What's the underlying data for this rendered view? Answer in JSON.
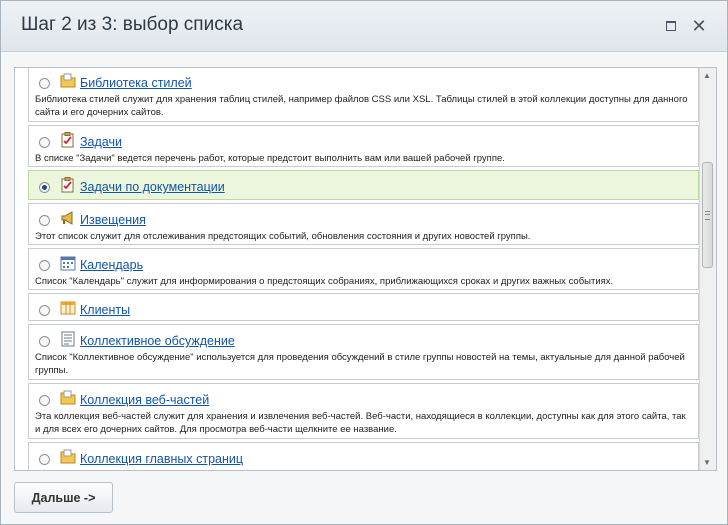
{
  "dialog": {
    "title": "Шаг 2 из 3: выбор списка",
    "maximize_icon": "maximize-icon",
    "close_icon": "close-icon",
    "close_glyph": "✕"
  },
  "items": [
    {
      "title": "Библиотека стилей",
      "icon": "folder-icon",
      "selected": false,
      "desc": "Библиотека стилей служит для хранения таблиц стилей, например файлов CSS или XSL. Таблицы стилей в этой коллекции доступны для данного сайта и его дочерних сайтов."
    },
    {
      "title": "Задачи",
      "icon": "tasks-icon",
      "selected": false,
      "desc": "В списке \"Задачи\" ведется перечень работ, которые предстоит выполнить вам или вашей рабочей группе."
    },
    {
      "title": "Задачи по документации",
      "icon": "tasks-icon",
      "selected": true,
      "desc": ""
    },
    {
      "title": "Извещения",
      "icon": "megaphone-icon",
      "selected": false,
      "desc": "Этот список служит для отслеживания предстоящих событий, обновления состояния и других новостей группы."
    },
    {
      "title": "Календарь",
      "icon": "calendar-icon",
      "selected": false,
      "desc": "Список \"Календарь\" служит для информирования о предстоящих собраниях, приближающихся сроках и других важных событиях."
    },
    {
      "title": "Клиенты",
      "icon": "table-icon",
      "selected": false,
      "desc": ""
    },
    {
      "title": "Коллективное обсуждение",
      "icon": "discussion-icon",
      "selected": false,
      "desc": "Список \"Коллективное обсуждение\" используется для проведения обсуждений в стиле группы новостей на темы, актуальные для данной рабочей группы."
    },
    {
      "title": "Коллекция веб-частей",
      "icon": "folder-icon",
      "selected": false,
      "desc": "Эта коллекция веб-частей служит для хранения и извлечения веб-частей. Веб-части, находящиеся в коллекции, доступны как для этого сайта, так и для всех его дочерних сайтов. Для просмотра веб-части щелкните ее название."
    },
    {
      "title": "Коллекция главных страниц",
      "icon": "folder-icon",
      "selected": false,
      "desc": ""
    }
  ],
  "scrollbar": {
    "up_icon": "scroll-up-icon",
    "down_icon": "scroll-down-icon",
    "up_glyph": "▲",
    "down_glyph": "▼"
  },
  "footer": {
    "next_label": "Дальше ->"
  },
  "colors": {
    "link": "#1155aa",
    "selected_row": "#ebf6dc",
    "radio_dot": "#1a4d8c"
  }
}
